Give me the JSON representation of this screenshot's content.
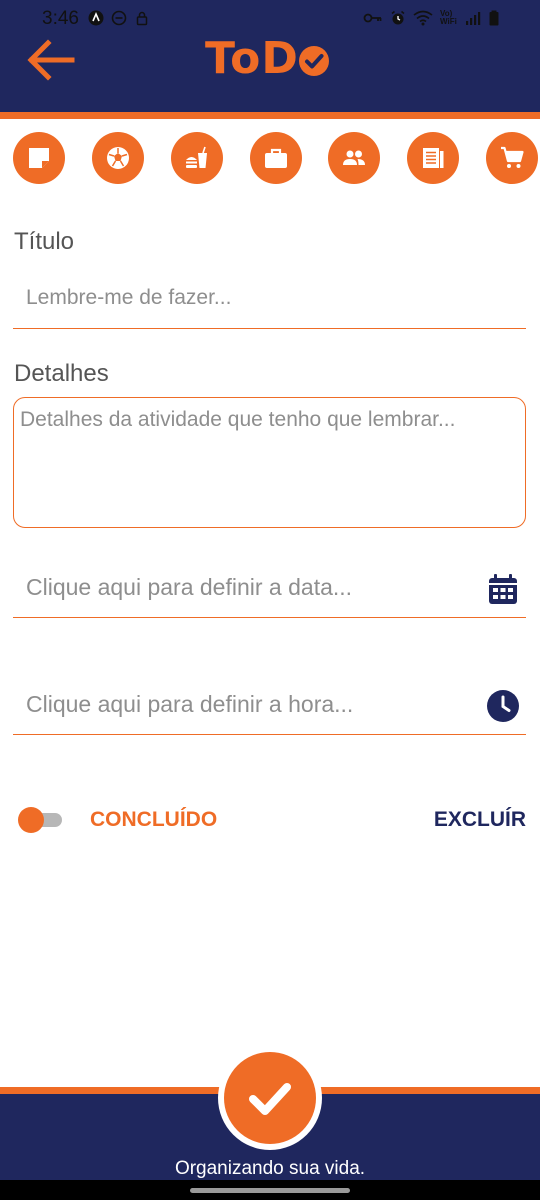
{
  "status_bar": {
    "time": "3:46",
    "left_icons": [
      "app-notification-icon",
      "do-not-disturb-icon",
      "lock-icon"
    ],
    "right_icons": [
      "vpn-key-icon",
      "alarm-icon",
      "wifi-icon",
      "signal-icon",
      "battery-icon"
    ],
    "network_label": "Vo) WiFi"
  },
  "header": {
    "back_icon": "arrow-left-icon",
    "logo_text": "ToD",
    "logo_check_icon": "check-circle-icon",
    "colors": {
      "navy": "#1f275e",
      "orange": "#ef6c26"
    }
  },
  "categories": [
    {
      "name": "note",
      "icon": "sticky-note-icon"
    },
    {
      "name": "sports",
      "icon": "soccer-ball-icon"
    },
    {
      "name": "food",
      "icon": "fastfood-icon"
    },
    {
      "name": "work",
      "icon": "briefcase-icon"
    },
    {
      "name": "people",
      "icon": "people-icon"
    },
    {
      "name": "news",
      "icon": "newspaper-icon"
    },
    {
      "name": "shopping",
      "icon": "cart-icon"
    }
  ],
  "form": {
    "title_label": "Título",
    "title_placeholder": "Lembre-me de fazer...",
    "details_label": "Detalhes",
    "details_placeholder": "Detalhes da atividade que tenho que lembrar...",
    "date_placeholder": "Clique aqui para definir a data...",
    "time_placeholder": "Clique aqui para definir a hora...",
    "date_icon": "calendar-icon",
    "time_icon": "clock-icon"
  },
  "actions": {
    "done_label": "CONCLUÍDO",
    "done_toggle_on": false,
    "delete_label": "EXCLUÍR"
  },
  "footer": {
    "fab_icon": "check-icon",
    "slogan": "Organizando sua vida."
  }
}
